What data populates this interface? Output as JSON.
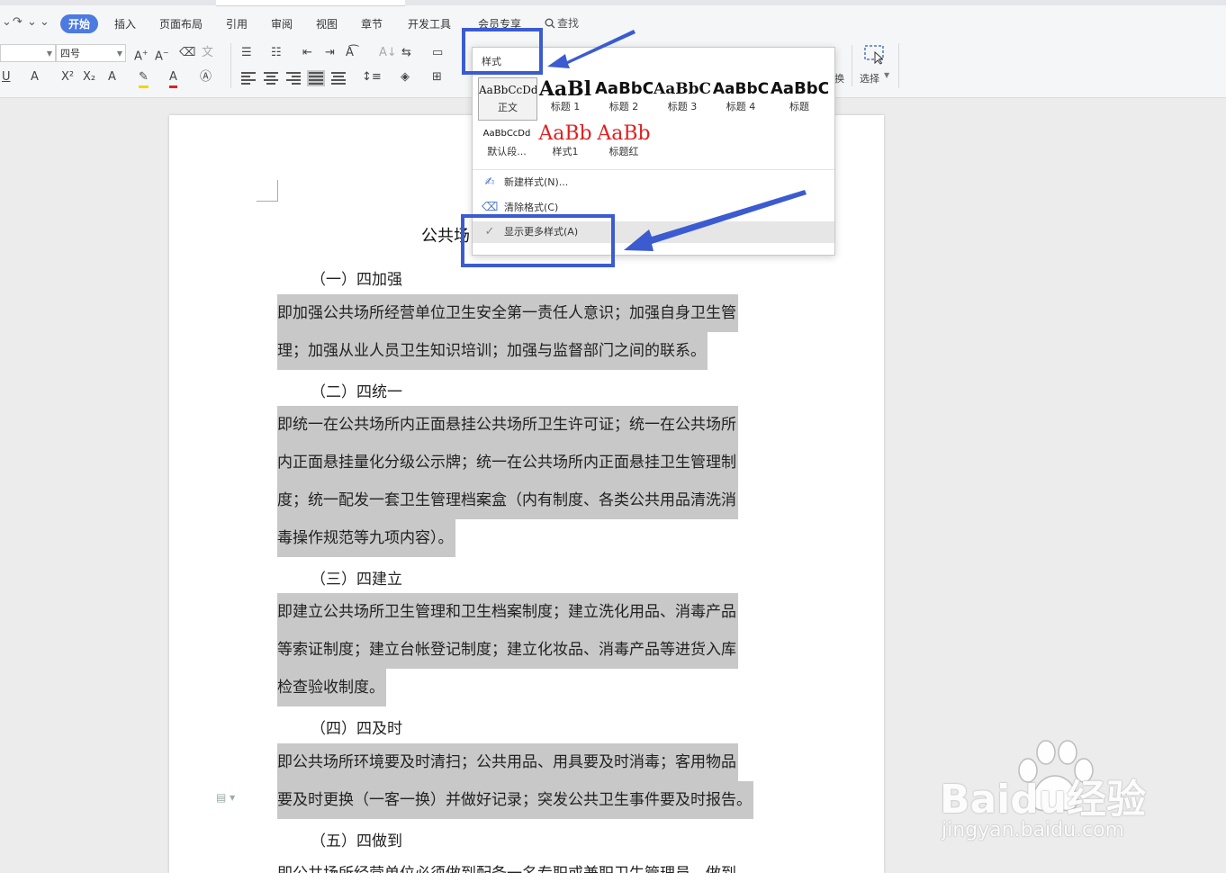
{
  "menu": {
    "tabs": [
      "开始",
      "插入",
      "页面布局",
      "引用",
      "审阅",
      "视图",
      "章节",
      "开发工具",
      "会员专享"
    ],
    "search_label": "查找"
  },
  "toolbar": {
    "font_size": "四号",
    "select_label": "选择",
    "replace_fragment": "换"
  },
  "styles_panel": {
    "header": "样式",
    "styles": [
      {
        "sample": "AaBbCcDd",
        "name": "正文"
      },
      {
        "sample": "AaBl",
        "name": "标题 1"
      },
      {
        "sample": "AaBbC",
        "name": "标题 2"
      },
      {
        "sample": "AaBbC",
        "name": "标题 3"
      },
      {
        "sample": "AaBbC",
        "name": "标题 4"
      },
      {
        "sample": "AaBbC",
        "name": "标题"
      },
      {
        "sample": "AaBbCcDd",
        "name": "默认段..."
      },
      {
        "sample": "AaBb",
        "name": "样式1"
      },
      {
        "sample": "AaBb",
        "name": "标题红"
      }
    ],
    "new_style": "新建样式(N)...",
    "clear_format": "清除格式(C)",
    "show_more": "显示更多样式(A)"
  },
  "document": {
    "title": "公共场",
    "sections": [
      {
        "heading": "（一）四加强",
        "lines": [
          "即加强公共场所经营单位卫生安全第一责任人意识；加强自身卫生管",
          "理；加强从业人员卫生知识培训；加强与监督部门之间的联系。"
        ]
      },
      {
        "heading": "（二）四统一",
        "lines": [
          "即统一在公共场所内正面悬挂公共场所卫生许可证；统一在公共场所",
          "内正面悬挂量化分级公示牌；统一在公共场所内正面悬挂卫生管理制",
          "度；统一配发一套卫生管理档案盒（内有制度、各类公共用品清洗消",
          "毒操作规范等九项内容）。"
        ]
      },
      {
        "heading": "（三）四建立",
        "lines": [
          "即建立公共场所卫生管理和卫生档案制度；建立洗化用品、消毒产品",
          "等索证制度；建立台帐登记制度；建立化妆品、消毒产品等进货入库",
          "检查验收制度。"
        ]
      },
      {
        "heading": "（四）四及时",
        "lines": [
          "即公共场所环境要及时清扫；公共用品、用具要及时消毒；客用物品",
          "要及时更换（一客一换）并做好记录；突发公共卫生事件要及时报告。"
        ]
      },
      {
        "heading": "（五）四做到",
        "lines": [
          "即公共场所经营单位必须做到配备一名专职或兼职卫生管理员，做到"
        ]
      }
    ]
  },
  "watermark": {
    "brand": "Baidu经验",
    "url": "jingyan.baidu.com"
  },
  "colors": {
    "accent": "#4c7ae0",
    "annotation": "#3b5bd0",
    "highlight": "#c8c8c8",
    "red_style": "#e02020"
  }
}
